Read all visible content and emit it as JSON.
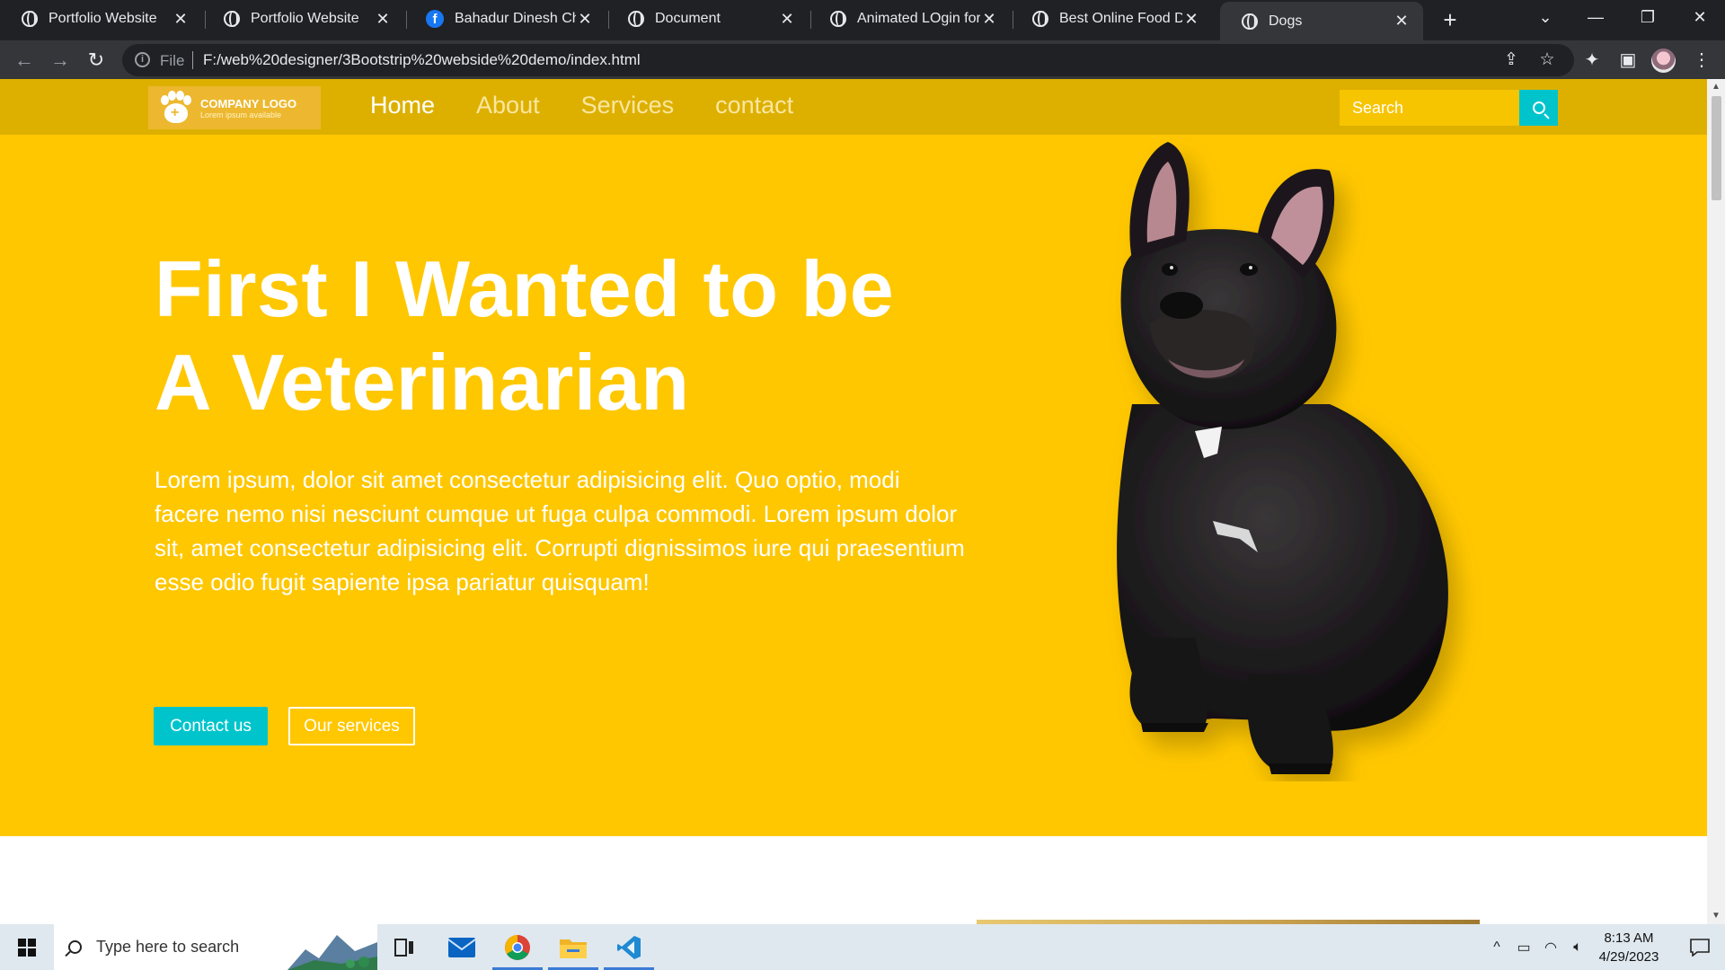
{
  "browser": {
    "tabs": [
      {
        "title": "Portfolio Website",
        "icon": "globe-icon"
      },
      {
        "title": "Portfolio Website",
        "icon": "globe-icon"
      },
      {
        "title": "Bahadur Dinesh Chan",
        "icon": "facebook-icon"
      },
      {
        "title": "Document",
        "icon": "globe-icon"
      },
      {
        "title": "Animated LOgin form",
        "icon": "globe-icon"
      },
      {
        "title": "Best Online Food Deli",
        "icon": "globe-icon"
      },
      {
        "title": "Dogs",
        "icon": "globe-icon",
        "active": true
      }
    ],
    "address": {
      "scheme_label": "File",
      "url": "F:/web%20designer/3Bootstrip%20webside%20demo/index.html"
    }
  },
  "site": {
    "logo": {
      "title": "COMPANY LOGO",
      "subtitle": "Lorem ipsum available"
    },
    "menu": [
      "Home",
      "About",
      "Services",
      "contact"
    ],
    "search": {
      "placeholder": "Search"
    },
    "hero": {
      "title_line1": "First I Wanted to be",
      "title_line2": "A Veterinarian",
      "text": "Lorem ipsum, dolor sit amet consectetur adipisicing elit. Quo optio, modi facere nemo nisi nesciunt cumque ut fuga culpa commodi. Lorem ipsum dolor sit, amet consectetur adipisicing elit. Corrupti dignissimos iure qui praesentium esse odio fugit sapiente ipsa pariatur quisquam!",
      "primary_button": "Contact us",
      "secondary_button": "Our services"
    },
    "colors": {
      "navbar": "#ddb000",
      "hero": "#ffc700",
      "accent": "#00c4cc"
    }
  },
  "taskbar": {
    "search_placeholder": "Type here to search",
    "time": "8:13 AM",
    "date": "4/29/2023"
  }
}
